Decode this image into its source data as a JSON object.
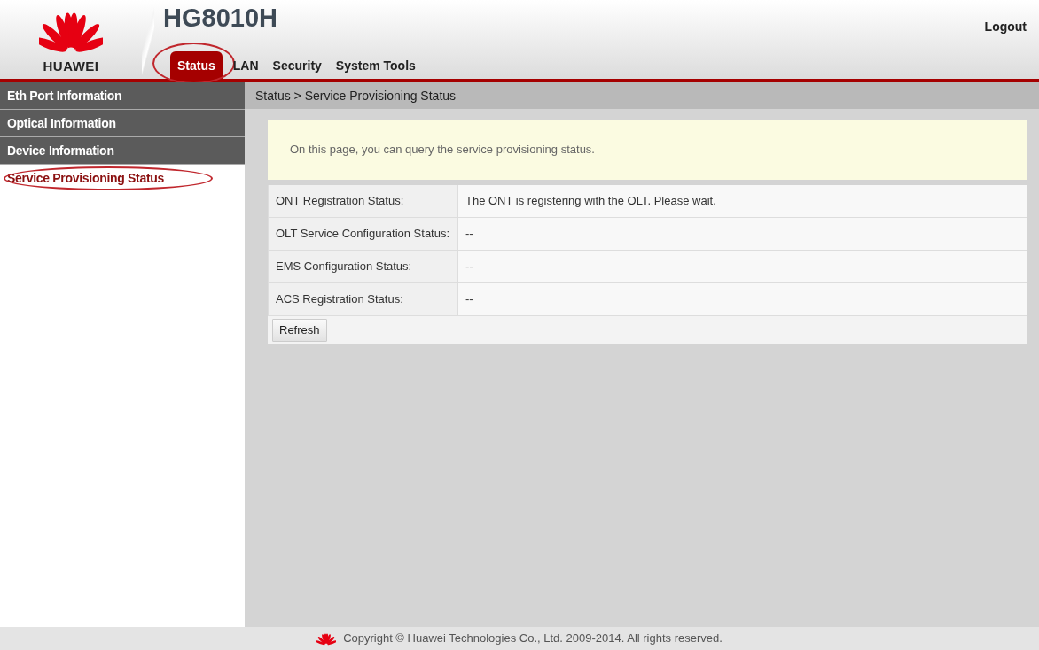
{
  "header": {
    "brand": "HUAWEI",
    "model": "HG8010H",
    "logout": "Logout"
  },
  "tabs": [
    {
      "label": "Status",
      "selected": true,
      "circled": true
    },
    {
      "label": "LAN",
      "selected": false,
      "circled": false
    },
    {
      "label": "Security",
      "selected": false,
      "circled": false
    },
    {
      "label": "System Tools",
      "selected": false,
      "circled": false
    }
  ],
  "sidebar": {
    "items": [
      {
        "label": "Eth Port Information",
        "selected": false,
        "circled": false
      },
      {
        "label": "Optical Information",
        "selected": false,
        "circled": false
      },
      {
        "label": "Device Information",
        "selected": false,
        "circled": false
      },
      {
        "label": "Service Provisioning Status",
        "selected": true,
        "circled": true
      }
    ]
  },
  "breadcrumb": "Status > Service Provisioning Status",
  "notice": "On this page, you can query the service provisioning status.",
  "table": {
    "rows": [
      {
        "label": "ONT Registration Status:",
        "value": "The ONT is registering with the OLT. Please wait."
      },
      {
        "label": "OLT Service Configuration Status:",
        "value": "--"
      },
      {
        "label": "EMS Configuration Status:",
        "value": "--"
      },
      {
        "label": "ACS Registration Status:",
        "value": "--"
      }
    ]
  },
  "buttons": [
    "Refresh"
  ],
  "footer": {
    "copyright": "Copyright © Huawei Technologies Co., Ltd. 2009-2014. All rights reserved."
  }
}
